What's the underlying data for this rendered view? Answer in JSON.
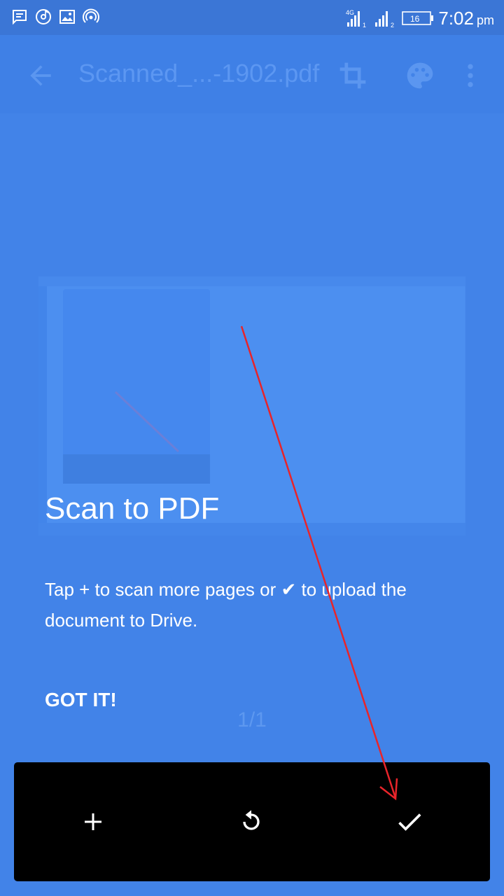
{
  "status_bar": {
    "time": "7:02",
    "ampm": "pm",
    "network_label": "4G",
    "sim1": "1",
    "sim2": "2",
    "battery": "16",
    "icons_left": [
      "message-icon",
      "music-disc-icon",
      "gallery-icon",
      "hotspot-icon"
    ]
  },
  "app_bar": {
    "title": "Scanned_...-1902.pdf",
    "icons": [
      "back-arrow-icon",
      "crop-icon",
      "palette-icon",
      "more-vert-icon"
    ]
  },
  "page_counter": "1/1",
  "tutorial": {
    "title": "Scan to PDF",
    "body": "Tap + to scan more pages or ✔ to upload the document to Drive.",
    "dismiss_label": "GOT IT!"
  },
  "toolbar": {
    "buttons": [
      "add-page-icon",
      "retake-icon",
      "confirm-check-icon"
    ]
  },
  "colors": {
    "overlay_blue": "#4283e8",
    "status_bar": "#3b76d6",
    "toolbar": "#000000",
    "annotation_arrow": "#e8242a"
  }
}
